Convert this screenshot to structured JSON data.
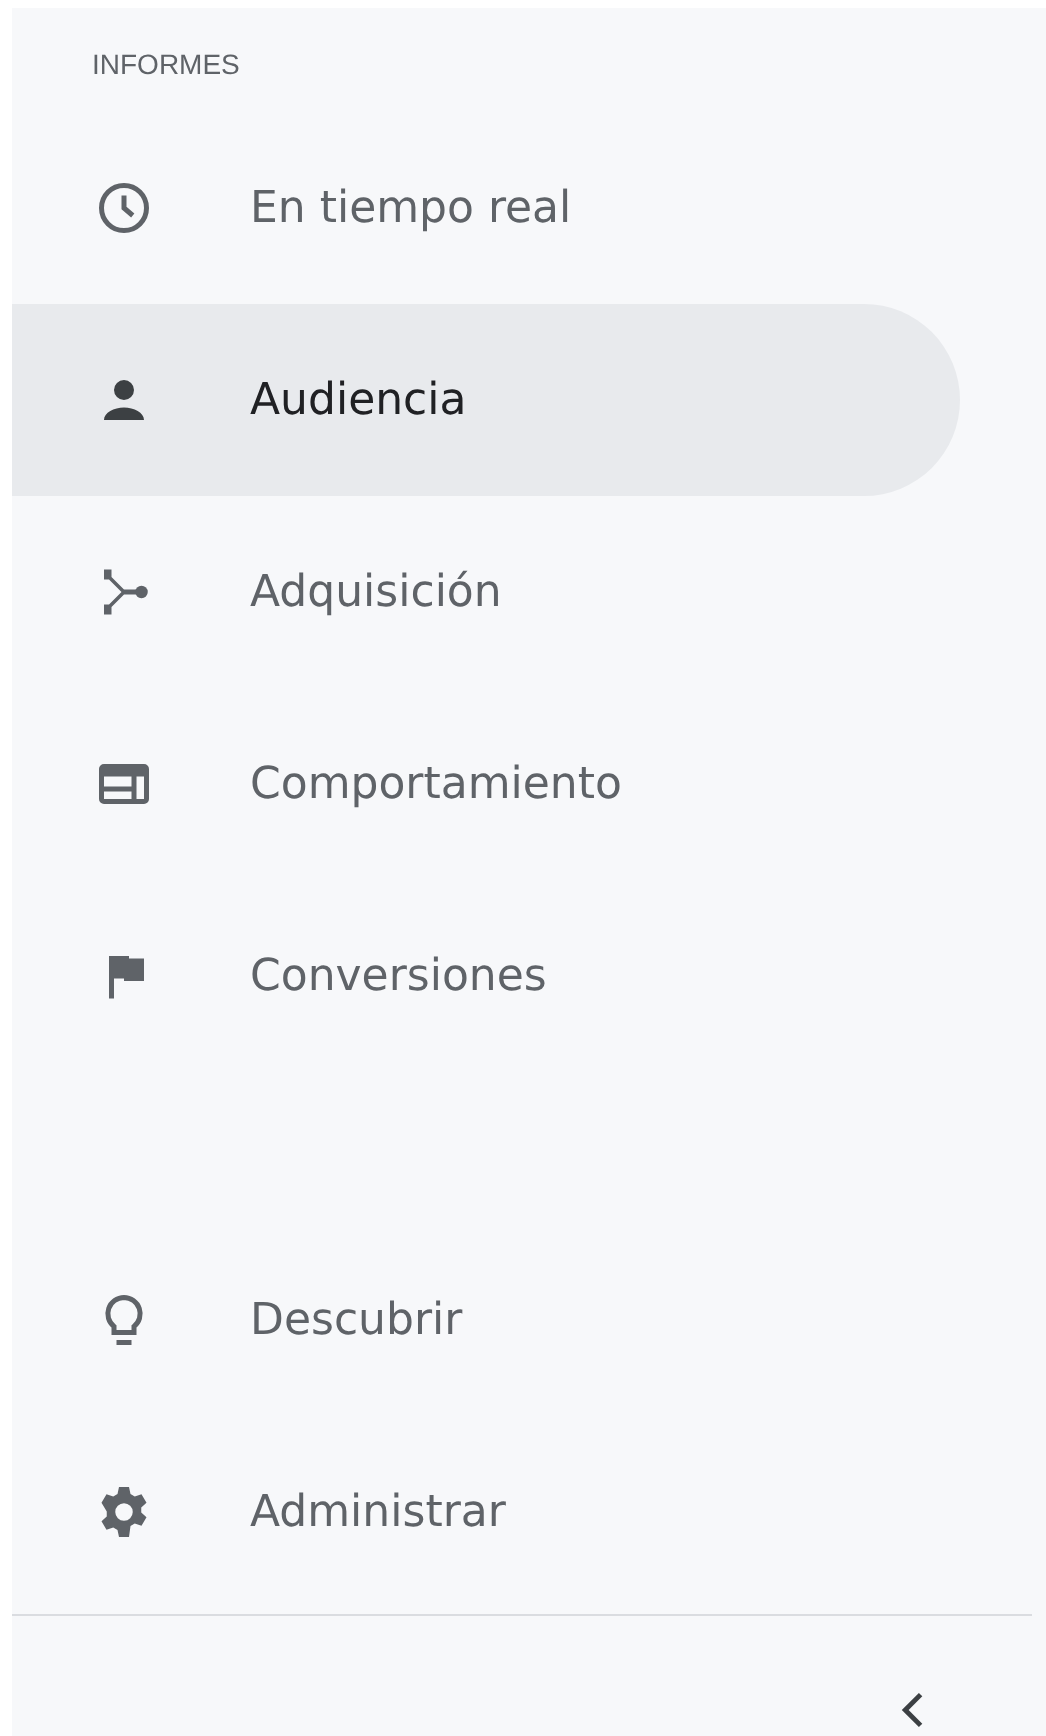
{
  "section_title": "INFORMES",
  "items": [
    {
      "label": "En tiempo real",
      "kind": "clock",
      "selected": false
    },
    {
      "label": "Audiencia",
      "kind": "person",
      "selected": true
    },
    {
      "label": "Adquisición",
      "kind": "merge",
      "selected": false
    },
    {
      "label": "Comportamiento",
      "kind": "layout",
      "selected": false
    },
    {
      "label": "Conversiones",
      "kind": "flag",
      "selected": false
    }
  ],
  "bottom_items": [
    {
      "label": "Descubrir",
      "kind": "bulb",
      "selected": false
    },
    {
      "label": "Administrar",
      "kind": "gear",
      "selected": false
    }
  ]
}
